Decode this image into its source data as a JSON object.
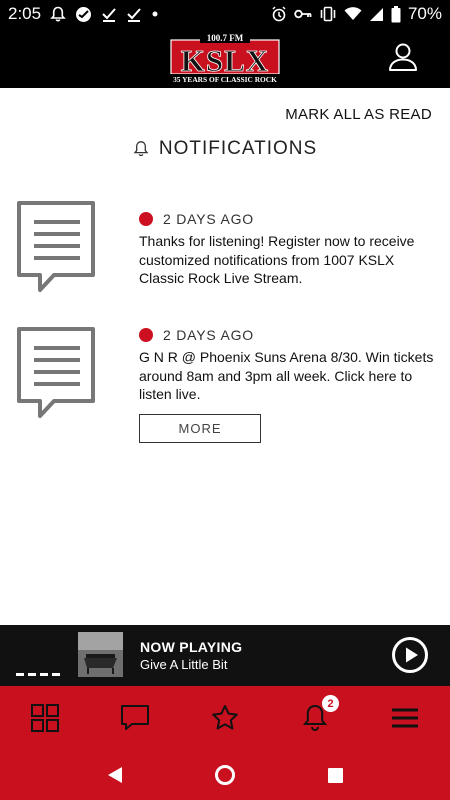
{
  "status_bar": {
    "time": "2:05",
    "battery": "70%"
  },
  "header": {
    "logo": {
      "frequency": "100.7 FM",
      "station": "KSLX",
      "tagline": "35 YEARS OF CLASSIC ROCK"
    }
  },
  "content": {
    "mark_all_label": "MARK ALL AS READ",
    "title": "NOTIFICATIONS",
    "notifications": [
      {
        "time": "2 DAYS AGO",
        "text": "Thanks for listening! Register now to receive customized notifications from 1007 KSLX Classic Rock Live Stream."
      },
      {
        "time": "2 DAYS AGO",
        "text": "G N R @ Phoenix Suns Arena 8/30. Win tickets around 8am and 3pm all week. Click here to listen live.",
        "button_label": "MORE"
      }
    ]
  },
  "now_playing": {
    "label": "NOW PLAYING",
    "track": "Give A Little Bit"
  },
  "bottom_nav": {
    "notification_badge": "2"
  },
  "colors": {
    "brand_red": "#c8101f",
    "dot_red": "#cc1021",
    "header_bg": "#000000",
    "player_bg": "#111111"
  }
}
